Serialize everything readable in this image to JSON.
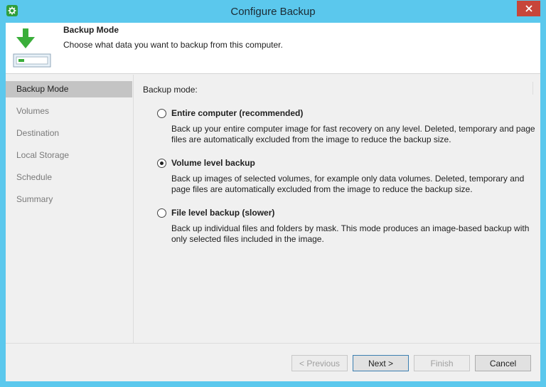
{
  "window": {
    "title": "Configure Backup",
    "app_icon": "gear-icon",
    "close_icon": "close-icon"
  },
  "header": {
    "title": "Backup Mode",
    "description": "Choose what data you want to backup from this computer.",
    "icon": "backup-download-icon"
  },
  "sidebar": {
    "items": [
      {
        "label": "Backup Mode",
        "active": true
      },
      {
        "label": "Volumes",
        "active": false
      },
      {
        "label": "Destination",
        "active": false
      },
      {
        "label": "Local Storage",
        "active": false
      },
      {
        "label": "Schedule",
        "active": false
      },
      {
        "label": "Summary",
        "active": false
      }
    ]
  },
  "content": {
    "section_label": "Backup mode:",
    "options": [
      {
        "title": "Entire computer (recommended)",
        "description": "Back up your entire computer image for fast recovery on any level. Deleted, temporary and page files are automatically excluded from the image to reduce the backup size.",
        "selected": false
      },
      {
        "title": "Volume level backup",
        "description": "Back up images of selected volumes, for example only data volumes. Deleted, temporary and page files are automatically excluded from the image to reduce the backup size.",
        "selected": true
      },
      {
        "title": "File level backup (slower)",
        "description": "Back up individual files and folders by mask. This mode produces an image-based backup with only selected files included in the image.",
        "selected": false
      }
    ]
  },
  "footer": {
    "previous_label": "< Previous",
    "next_label": "Next >",
    "finish_label": "Finish",
    "cancel_label": "Cancel"
  },
  "colors": {
    "title_bar": "#5bc8ed",
    "close_button": "#c7463a",
    "active_nav": "#c4c4c4",
    "icon_green": "#3aae3a"
  }
}
